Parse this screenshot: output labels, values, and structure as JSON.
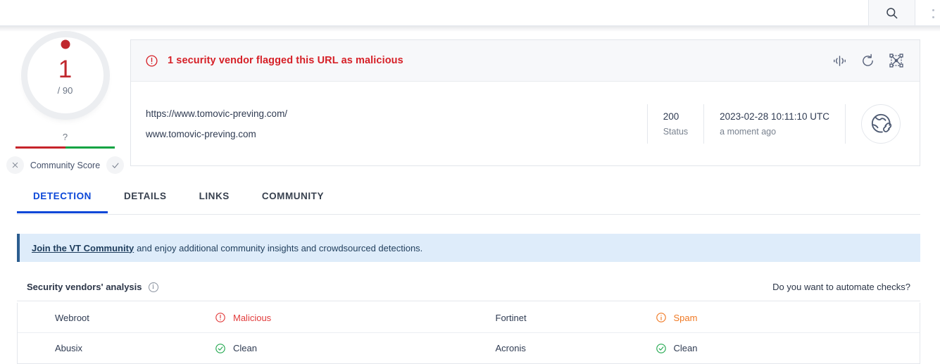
{
  "topbar": {
    "search_icon": "search-icon"
  },
  "score": {
    "value": "1",
    "denominator": "/ 90",
    "question_mark": "?",
    "community_label": "Community Score",
    "downvote_icon": "x-icon",
    "upvote_icon": "check-icon",
    "bar_red": "#c6242a",
    "bar_green": "#0fa343",
    "accent": "#c0272d"
  },
  "card": {
    "verdict_text": "1 security vendor flagged this URL as malicious",
    "verdict_color": "#d62027",
    "alert_icon": "exclamation-circle-icon",
    "actions": [
      {
        "name": "signal-exchange-icon"
      },
      {
        "name": "reanalyze-icon"
      },
      {
        "name": "similar-graph-icon"
      }
    ],
    "url_primary": "https://www.tomovic-preving.com/",
    "url_secondary": "www.tomovic-preving.com",
    "status_code": "200",
    "status_label": "Status",
    "scan_time": "2023-02-28 10:11:10 UTC",
    "scan_relative": "a moment ago",
    "type_icon": "globe-link-icon"
  },
  "tabs": [
    {
      "label": "DETECTION",
      "active": true
    },
    {
      "label": "DETAILS",
      "active": false
    },
    {
      "label": "LINKS",
      "active": false
    },
    {
      "label": "COMMUNITY",
      "active": false
    }
  ],
  "join_banner": {
    "link_text": "Join the VT Community",
    "rest_text": " and enjoy additional community insights and crowdsourced detections."
  },
  "vendors_section": {
    "title": "Security vendors' analysis",
    "info_icon": "info-icon",
    "info_glyph": "i",
    "automate_text": "Do you want to automate checks?"
  },
  "vendors": [
    {
      "left": {
        "name": "Webroot",
        "verdict": "Malicious",
        "state": "malicious",
        "icon": "exclamation-circle-icon"
      },
      "right": {
        "name": "Fortinet",
        "verdict": "Spam",
        "state": "spam",
        "icon": "info-circle-icon"
      }
    },
    {
      "left": {
        "name": "Abusix",
        "verdict": "Clean",
        "state": "clean",
        "icon": "check-circle-icon"
      },
      "right": {
        "name": "Acronis",
        "verdict": "Clean",
        "state": "clean",
        "icon": "check-circle-icon"
      }
    }
  ],
  "colors": {
    "blue_accent": "#0b47d8",
    "malicious": "#e23b3b",
    "spam": "#f07822",
    "clean_icon": "#22a84f",
    "banner_bg": "#deecfa"
  }
}
